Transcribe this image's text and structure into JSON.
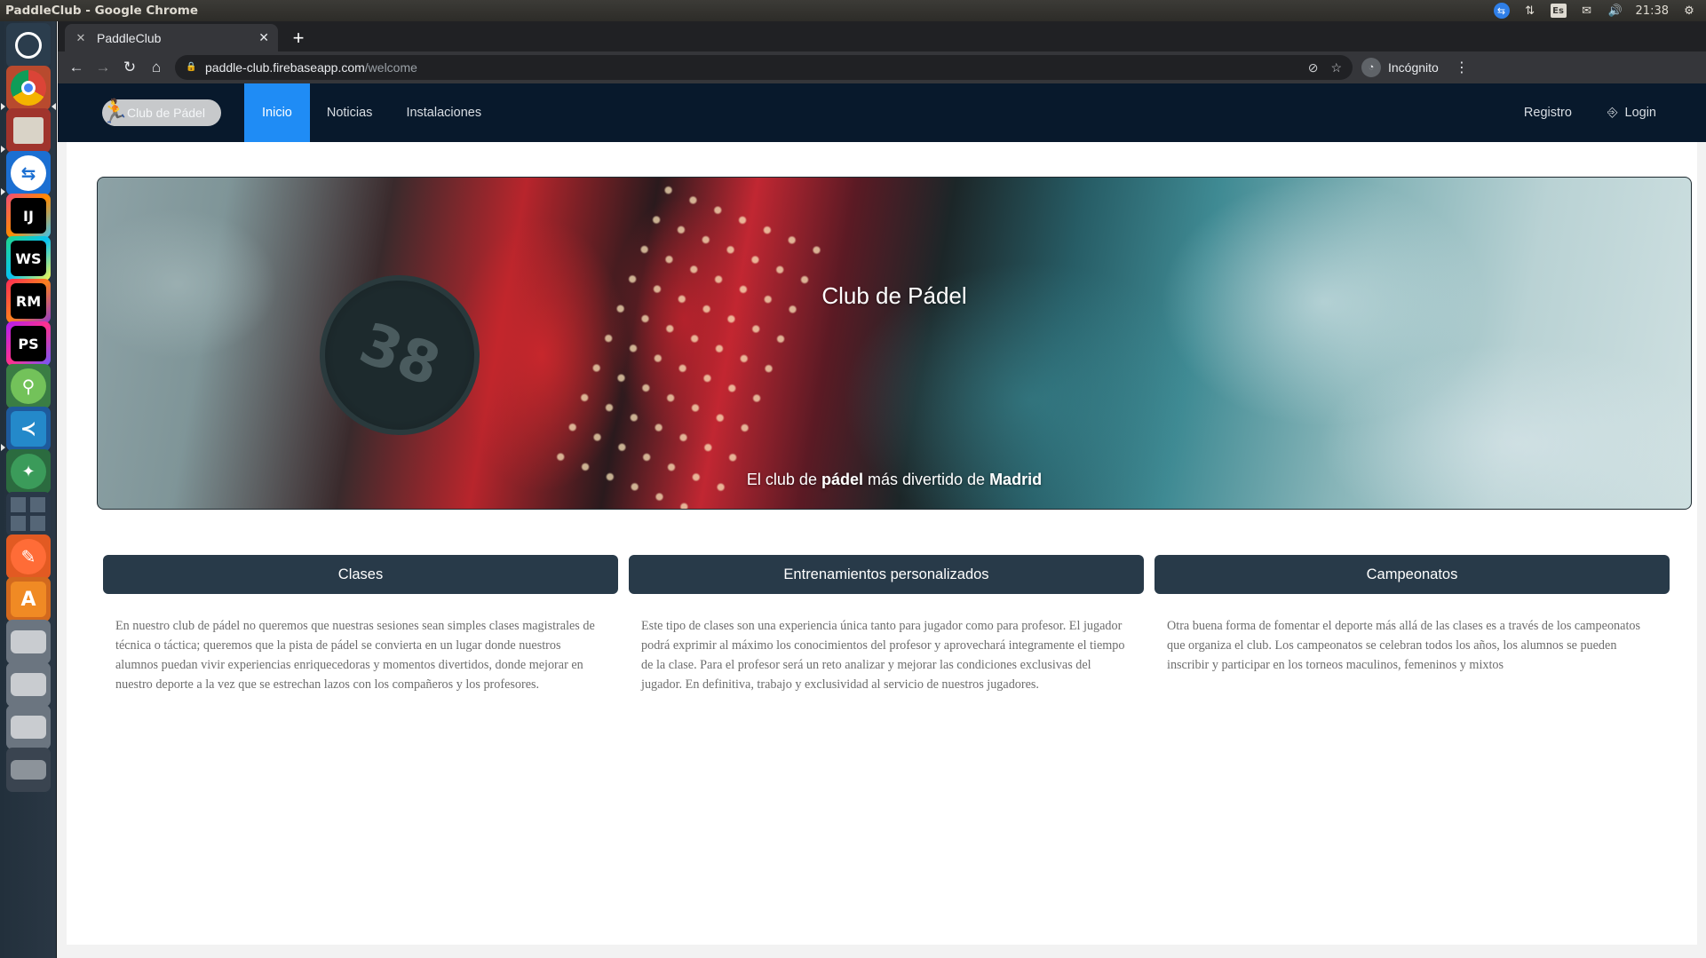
{
  "os": {
    "window_title": "PaddleClub - Google Chrome",
    "clock": "21:38",
    "keyboard_layout": "Es",
    "launcher_apps": [
      {
        "icon": "ubuntu-dash-icon",
        "label": ""
      },
      {
        "icon": "chrome-icon",
        "label": ""
      },
      {
        "icon": "file-manager-icon",
        "label": ""
      },
      {
        "icon": "teamviewer-icon",
        "label": ""
      },
      {
        "icon": "intellij-icon",
        "label": "IJ"
      },
      {
        "icon": "webstorm-icon",
        "label": "WS"
      },
      {
        "icon": "rubymine-icon",
        "label": "RM"
      },
      {
        "icon": "phpstorm-icon",
        "label": "PS"
      },
      {
        "icon": "android-studio-icon",
        "label": ""
      },
      {
        "icon": "vscode-icon",
        "label": ""
      },
      {
        "icon": "gitkraken-icon",
        "label": ""
      },
      {
        "icon": "workspace-switcher-icon",
        "label": ""
      },
      {
        "icon": "postman-icon",
        "label": ""
      },
      {
        "icon": "software-center-icon",
        "label": ""
      },
      {
        "icon": "drive-icon",
        "label": ""
      },
      {
        "icon": "drive-icon",
        "label": ""
      },
      {
        "icon": "drive-icon",
        "label": ""
      },
      {
        "icon": "drive-icon",
        "label": ""
      }
    ]
  },
  "browser": {
    "tab_title": "PaddleClub",
    "url_host": "paddle-club.firebaseapp.com",
    "url_path": "/welcome",
    "profile_label": "Incógnito"
  },
  "site": {
    "brand_label": "Club de Pádel",
    "nav": [
      {
        "label": "Inicio",
        "active": true
      },
      {
        "label": "Noticias",
        "active": false
      },
      {
        "label": "Instalaciones",
        "active": false
      }
    ],
    "register_label": "Registro",
    "login_label": "Login",
    "accent_color": "#1f8cf5",
    "navbar_color": "#08192c"
  },
  "hero": {
    "title": "Club de Pádel",
    "subtitle_part1": "El club de ",
    "subtitle_bold1": "pádel",
    "subtitle_part2": " más divertido de ",
    "subtitle_bold2": "Madrid",
    "badge_number": "38"
  },
  "cards": [
    {
      "title": "Clases",
      "text": "En nuestro club de pádel no queremos que nuestras sesiones sean simples clases magistrales de técnica o táctica; queremos que la pista de pádel se convierta en un lugar donde nuestros alumnos puedan vivir experiencias enriquecedoras y momentos divertidos, donde mejorar en nuestro deporte a la vez que se estrechan lazos con los compañeros y los profesores."
    },
    {
      "title": "Entrenamientos personalizados",
      "text": "Este tipo de clases son una experiencia única tanto para jugador como para profesor. El jugador podrá exprimir al máximo los conocimientos del profesor y aprovechará integramente el tiempo de la clase. Para el profesor será un reto analizar y mejorar las condiciones exclusivas del jugador. En definitiva, trabajo y exclusividad al servicio de nuestros jugadores."
    },
    {
      "title": "Campeonatos",
      "text": "Otra buena forma de fomentar el deporte más allá de las clases es a través de los campeonatos que organiza el club. Los campeonatos se celebran todos los años, los alumnos se pueden inscribir y participar en los torneos maculinos, femeninos y mixtos"
    }
  ]
}
